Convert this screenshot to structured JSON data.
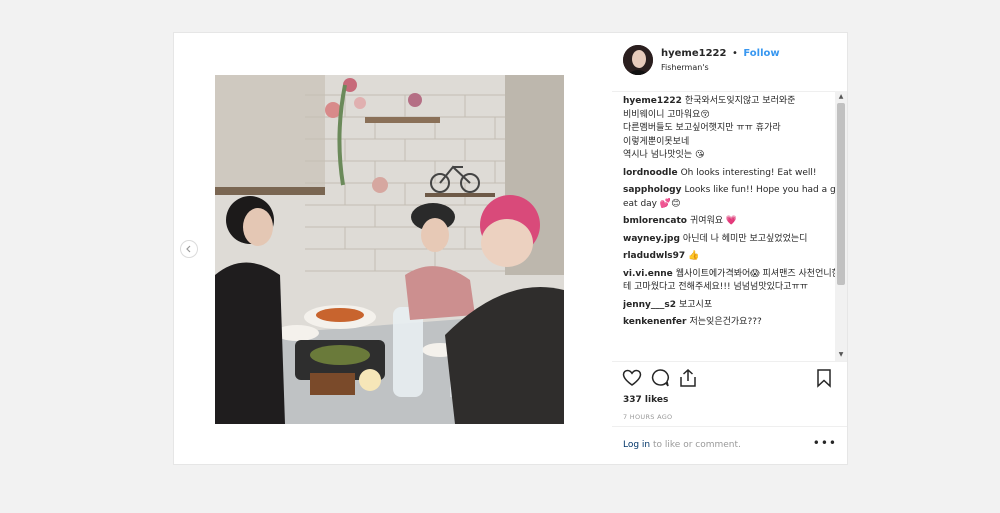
{
  "post": {
    "username": "hyeme1222",
    "separator": "•",
    "follow_label": "Follow",
    "location": "Fisherman's"
  },
  "comments": [
    {
      "author": "hyeme1222",
      "lines": [
        "한국와서도잊지않고 보러와준",
        "비비웨이니 고마워요😚",
        "다른멤버들도 보고싶어햇지만 ㅠㅠ 휴가라",
        "이렇게뿐이못보네",
        "역시나 넘나맛잇는 😘"
      ]
    },
    {
      "author": "lordnoodle",
      "text": "Oh looks interesting! Eat well!"
    },
    {
      "author": "sapphology",
      "text": "Looks like fun!! Hope you had a great day 💕😊"
    },
    {
      "author": "bmlorencato",
      "text": "귀여워요 💗"
    },
    {
      "author": "wayney.jpg",
      "text": "아닌데 나 헤미만 보고싶었었는디"
    },
    {
      "author": "rladudwls97",
      "text": "👍"
    },
    {
      "author": "vi.vi.enne",
      "text": "웹사이트에가격봐어😱 피셔맨즈 사천언니한테 고마웠다고 전해주세요!!! 넘넘넘맛있다고ㅠㅠ"
    },
    {
      "author": "jenny___s2",
      "text": "보고시포"
    },
    {
      "author": "kenkenenfer",
      "text": "저는잊은건가요???"
    }
  ],
  "icons": {
    "like": "heart-icon",
    "comment": "speech-bubble-icon",
    "share": "share-icon",
    "save": "bookmark-icon",
    "prev": "chevron-left-icon",
    "more": "more-options-icon"
  },
  "likes": "337 likes",
  "timestamp": "7 HOURS AGO",
  "add_comment": {
    "login_link": "Log in",
    "login_rest": " to like or comment.",
    "more_label": "•••"
  },
  "colors": {
    "accent": "#3897f0",
    "link": "#003569",
    "muted": "#999999",
    "background": "#f2f2f2"
  }
}
